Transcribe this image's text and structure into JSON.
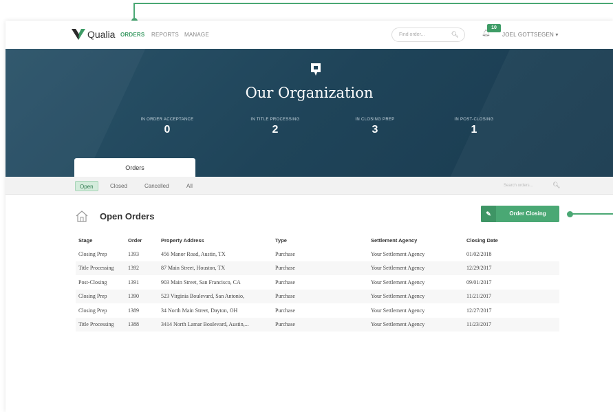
{
  "nav": {
    "brand": "Qualia",
    "links": [
      "ORDERS",
      "REPORTS",
      "MANAGE"
    ],
    "search_placeholder": "Find order...",
    "notification_count": "10",
    "user_name": "JOEL GOTTSEGEN ▾"
  },
  "hero": {
    "title": "Our Organization",
    "stats": [
      {
        "label": "IN ORDER ACCEPTANCE",
        "value": "0"
      },
      {
        "label": "IN TITLE PROCESSING",
        "value": "2"
      },
      {
        "label": "IN CLOSING PREP",
        "value": "3"
      },
      {
        "label": "IN POST-CLOSING",
        "value": "1"
      }
    ],
    "tab_label": "Orders"
  },
  "filters": {
    "items": [
      "Open",
      "Closed",
      "Cancelled",
      "All"
    ],
    "selected": "Open",
    "search_placeholder": "Search orders..."
  },
  "section": {
    "title": "Open Orders",
    "action_button": "Order Closing"
  },
  "table": {
    "columns": [
      "Stage",
      "Order",
      "Property Address",
      "Type",
      "Settlement Agency",
      "Closing Date"
    ],
    "rows": [
      [
        "Closing Prep",
        "1393",
        "456 Manor Road, Austin, TX",
        "Purchase",
        "Your Settlement Agency",
        "01/02/2018"
      ],
      [
        "Title Processing",
        "1392",
        "87 Main Street, Houston, TX",
        "Purchase",
        "Your Settlement Agency",
        "12/29/2017"
      ],
      [
        "Post-Closing",
        "1391",
        "903 Main Street, San Francisco, CA",
        "Purchase",
        "Your Settlement Agency",
        "09/01/2017"
      ],
      [
        "Closing Prep",
        "1390",
        "523 Virginia Boulevard, San Antonio,",
        "Purchase",
        "Your Settlement Agency",
        "11/21/2017"
      ],
      [
        "Closing Prep",
        "1389",
        "34 North Main Street, Dayton, OH",
        "Purchase",
        "Your Settlement Agency",
        "12/27/2017"
      ],
      [
        "Title Processing",
        "1388",
        "3414 North Lamar Boulevard, Austin,...",
        "Purchase",
        "Your Settlement Agency",
        "11/23/2017"
      ]
    ]
  },
  "colors": {
    "accent": "#4aa874",
    "hero_bg": "#1f4459"
  }
}
